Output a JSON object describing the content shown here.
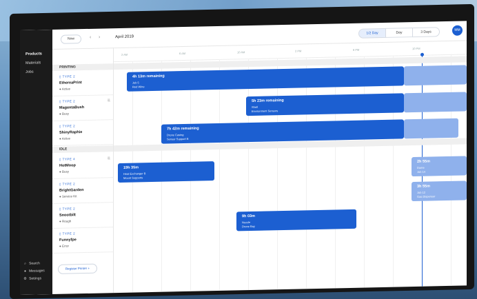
{
  "sidebar": {
    "nav": [
      "Products",
      "Materials",
      "Jobs"
    ],
    "bottom": [
      {
        "icon": "search-icon",
        "glyph": "⌕",
        "label": "Search"
      },
      {
        "icon": "message-icon",
        "glyph": "●",
        "label": "Messages"
      },
      {
        "icon": "gear-icon",
        "glyph": "⚙",
        "label": "Settings"
      }
    ]
  },
  "topbar": {
    "today_label": "Now",
    "prev_glyph": "‹",
    "next_glyph": "›",
    "month": "April 2019",
    "views": [
      "1/2 Day",
      "Day",
      "3 Days"
    ],
    "avatar": "MM"
  },
  "timeline": {
    "ticks": [
      "2 AM",
      "6 AM",
      "10 AM",
      "2 PM",
      "6 PM",
      "10 PM"
    ]
  },
  "groups": [
    {
      "label": "PRINTING"
    },
    {
      "label": "IDLE"
    }
  ],
  "resources": [
    {
      "type": "▯ TYPE 2",
      "name": "EthereaPrint",
      "status": "● Active"
    },
    {
      "type": "▯ TYPE 2",
      "name": "MagentaBush",
      "status": "● Busy"
    },
    {
      "type": "▯ TYPE 2",
      "name": "ShinyRaphie",
      "status": "● Active"
    },
    {
      "type": "▯ TYPE 4",
      "name": "HotMoop",
      "status": "● Busy"
    },
    {
      "type": "▯ TYPE 2",
      "name": "BrightGarden",
      "status": "● Service Kit"
    },
    {
      "type": "▯ TYPE 2",
      "name": "Snootbilt",
      "status": "● Rough"
    },
    {
      "type": "▯ TYPE 2",
      "name": "Funnyfpe",
      "status": "● Error"
    }
  ],
  "jobs": [
    {
      "title": "4h 13m remaining",
      "line1": "Job 5",
      "line2": "Red Wine"
    },
    {
      "title": "5h 23m remaining",
      "line1": "Shell",
      "line2": "Environment Sensors"
    },
    {
      "title": "7h 42m remaining",
      "line1": "Drone Casing",
      "line2": "Sensor Support B"
    },
    {
      "title": "19h 35m",
      "line1": "Heat Exchanger B",
      "line2": "Mount Supports"
    },
    {
      "title": "2h 55m",
      "line1": "Dome",
      "line2": "Job 14"
    },
    {
      "title": "3h 55m",
      "line1": "Job 12",
      "line2": "Gas Dispenser"
    },
    {
      "title": "9h 03m",
      "line1": "Nozzle",
      "line2": "Drone Bay"
    }
  ],
  "register_button": "Register Printer +",
  "colors": {
    "accent": "#1c5fd1",
    "accent_light": "#8fb1ec",
    "sidebar": "#1b1b1b"
  }
}
